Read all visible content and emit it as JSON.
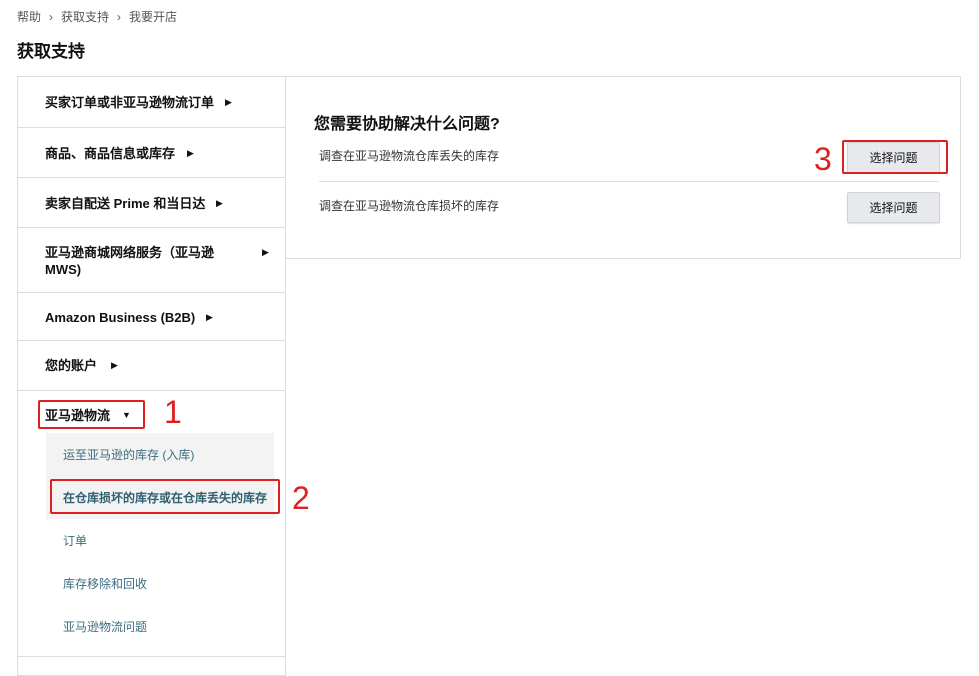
{
  "breadcrumb": {
    "items": [
      "帮助",
      "获取支持",
      "我要开店"
    ],
    "separator": "›"
  },
  "page_title": "获取支持",
  "sidebar": {
    "categories": [
      {
        "label": "买家订单或非亚马逊物流订单",
        "arrow": "▶"
      },
      {
        "label": "商品、商品信息或库存",
        "arrow": "▶"
      },
      {
        "label": "卖家自配送 Prime 和当日达",
        "arrow": "▶"
      },
      {
        "label": "亚马逊商城网络服务（亚马逊 MWS)",
        "arrow": "▶"
      },
      {
        "label": "Amazon Business (B2B)",
        "arrow": "▶"
      },
      {
        "label": "您的账户",
        "arrow": "▶"
      },
      {
        "label": "亚马逊物流",
        "arrow": "▼"
      }
    ],
    "subitems": [
      {
        "label": "运至亚马逊的库存 (入库)"
      },
      {
        "label": "在仓库损坏的库存或在仓库丢失的库存"
      },
      {
        "label": "订单"
      },
      {
        "label": "库存移除和回收"
      },
      {
        "label": "亚马逊物流问题"
      }
    ]
  },
  "main": {
    "heading": "您需要协助解决什么问题?",
    "issues": [
      {
        "text": "调查在亚马逊物流仓库丢失的库存",
        "button": "选择问题"
      },
      {
        "text": "调查在亚马逊物流仓库损坏的库存",
        "button": "选择问题"
      }
    ]
  },
  "annotations": [
    "1",
    "2",
    "3"
  ],
  "colors": {
    "annotation": "#e02020",
    "link": "#3b6c7e",
    "border": "#dddddd",
    "selected_bg": "#f3f3f3",
    "button_bg": "#e7e9ec"
  }
}
